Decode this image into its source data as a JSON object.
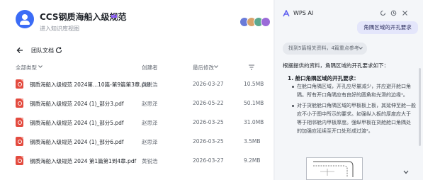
{
  "header": {
    "title": "CCS钢质海船入级规范",
    "subtitle": "进入知识库视图"
  },
  "toolbar": {
    "breadcrumb": "团队文档"
  },
  "table": {
    "columns": {
      "type": "全部类型",
      "creator": "创建者",
      "modified": "最后修改"
    },
    "rows": [
      {
        "name": "钢质海船入级规范 2024第...10篇-第9篇第3章.pdf",
        "creator": "黄锐浩",
        "date": "2026-03-27",
        "size": "10.5MB"
      },
      {
        "name": "钢质海船入级规范 2024 (1)_部分3.pdf",
        "creator": "赵思泽",
        "date": "2026-05-22",
        "size": "50.1MB"
      },
      {
        "name": "钢质海船入级规范 2024 (1)_部分5.pdf",
        "creator": "赵思泽",
        "date": "2026-03-25",
        "size": "31.0MB"
      },
      {
        "name": "钢质海船入级规范 2024 (1)_部分6.pdf",
        "creator": "赵思泽",
        "date": "2026-03-25",
        "size": "3.5MB"
      },
      {
        "name": "钢质海船入级规范 2024 第1篇第1到4章.pdf",
        "creator": "黄锐浩",
        "date": "2026-03-27",
        "size": "9.2MB"
      }
    ]
  },
  "ai_panel": {
    "title": "WPS AI",
    "user_message": "角隅区域的开孔要求",
    "status": "找到5篇相关资料，4篇重点参考",
    "intro": "根据提供的资料，角隅区域的开孔要求如下：",
    "section_title": "1. 舱口角隅区域的开孔要求：",
    "bullet1_lines": [
      "在舱口角隅区域，开孔应尽量减少，并应避开舱口角",
      "隅。所有开口角隅应有良好的圆角和光滑的边缘¹。"
    ],
    "bullet2_lines": [
      "对于货舱舱口角隅区域的甲板板上板，其延伸至舱一般",
      "应不小于图中所示的要求。如强纵入板的厚度应大于",
      "等于相邻舱内甲板厚度。强纵甲板在货舱舱口角隅处",
      "的加强应延续至开口处形成过渡²。"
    ]
  },
  "colors": {
    "accent": "#3b6cf6",
    "pdf_red": "#e34b3f",
    "bubble": "#e4e6fb"
  },
  "icons": [
    "team-avatar-icon",
    "crown-icon",
    "back-arrow-icon",
    "refresh-icon",
    "filter-icon",
    "pdf-file-icon",
    "wps-ai-logo-icon",
    "loading-icon",
    "history-icon",
    "close-icon",
    "chevron-down-icon"
  ]
}
